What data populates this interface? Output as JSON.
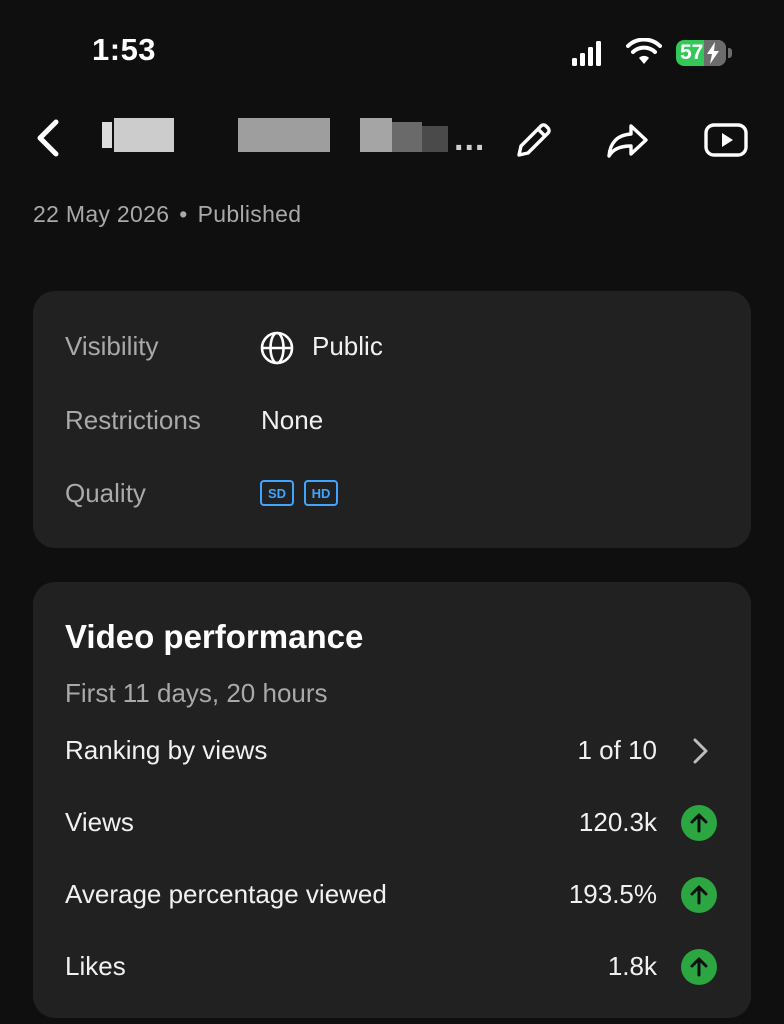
{
  "status_bar": {
    "time": "1:53",
    "battery_level": "57",
    "battery_fraction": 0.57,
    "signal_icon": "cellular-signal-icon",
    "wifi_icon": "wifi-icon",
    "battery_icon": "battery-charging-icon"
  },
  "header": {
    "title_ellipsis": "...",
    "back_icon": "chevron-left-icon",
    "edit_icon": "pencil-icon",
    "share_icon": "share-arrow-icon",
    "play_icon": "play-video-icon"
  },
  "meta": {
    "date": "22 May 2026",
    "separator": "•",
    "status": "Published"
  },
  "details": {
    "visibility_label": "Visibility",
    "visibility_value": "Public",
    "visibility_icon": "globe-icon",
    "restrictions_label": "Restrictions",
    "restrictions_value": "None",
    "quality_label": "Quality",
    "quality_badges": [
      "SD",
      "HD"
    ]
  },
  "performance": {
    "title": "Video performance",
    "period": "First 11 days, 20 hours",
    "metrics": [
      {
        "label": "Ranking by views",
        "value": "1 of 10",
        "indicator": "chevron-right-icon"
      },
      {
        "label": "Views",
        "value": "120.3k",
        "indicator": "trend-up-icon"
      },
      {
        "label": "Average percentage viewed",
        "value": "193.5%",
        "indicator": "trend-up-icon"
      },
      {
        "label": "Likes",
        "value": "1.8k",
        "indicator": "trend-up-icon"
      }
    ]
  },
  "colors": {
    "background": "#0f0f0f",
    "card": "#212121",
    "accent_blue": "#3ea6ff",
    "trend_green": "#2ba640",
    "battery_green": "#34c759"
  }
}
